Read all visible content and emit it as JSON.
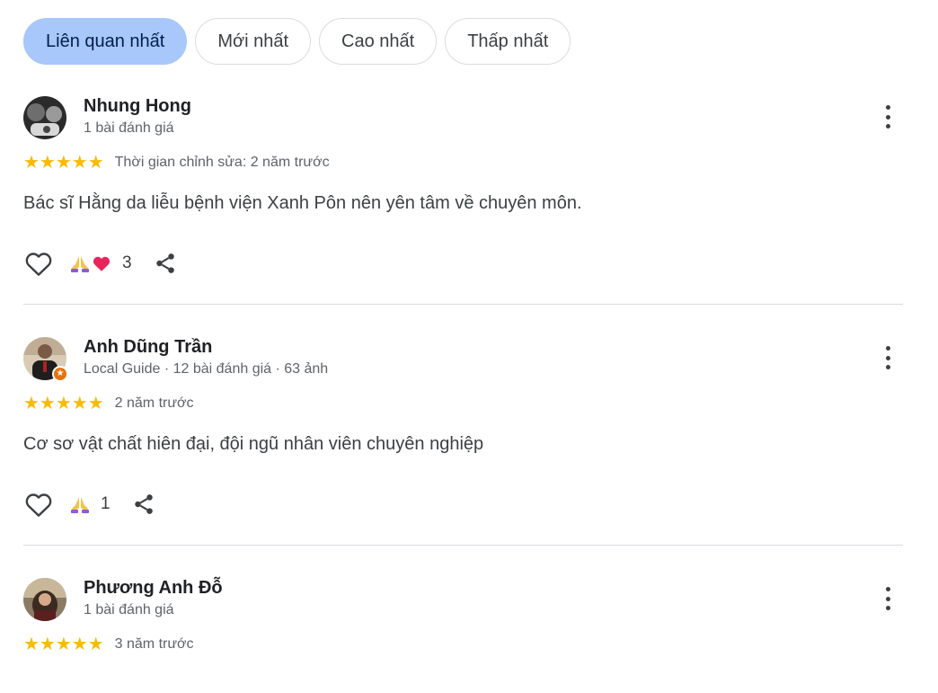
{
  "sort_tabs": [
    {
      "label": "Liên quan nhất",
      "active": true
    },
    {
      "label": "Mới nhất",
      "active": false
    },
    {
      "label": "Cao nhất",
      "active": false
    },
    {
      "label": "Thấp nhất",
      "active": false
    }
  ],
  "reviews": [
    {
      "name": "Nhung Hong",
      "meta": "1 bài đánh giá",
      "rating": 5,
      "stars": "★★★★★",
      "date": "Thời gian chỉnh sửa: 2 năm trước",
      "text": "Bác sĩ Hằng da liễu bệnh viện Xanh Pôn nên yên tâm về chuyên môn.",
      "reaction_count": "3",
      "reactions": [
        "pray-emoji",
        "heart-emoji"
      ],
      "local_guide": false
    },
    {
      "name": "Anh Dũng Trần",
      "meta": "Local Guide · 12 bài đánh giá · 63 ảnh",
      "rating": 5,
      "stars": "★★★★★",
      "date": "2 năm trước",
      "text": "Cơ sơ vật chất hiên đại, đội ngũ nhân viên chuyên nghiệp",
      "reaction_count": "1",
      "reactions": [
        "pray-emoji"
      ],
      "local_guide": true
    },
    {
      "name": "Phương Anh Đỗ",
      "meta": "1 bài đánh giá",
      "rating": 5,
      "stars": "★★★★★",
      "date": "3 năm trước",
      "local_guide": false
    }
  ],
  "colors": {
    "active_tab": "#a8c7fa",
    "star": "#f9bb04",
    "local_guide_badge": "#e8710a",
    "divider": "#dadce0"
  }
}
